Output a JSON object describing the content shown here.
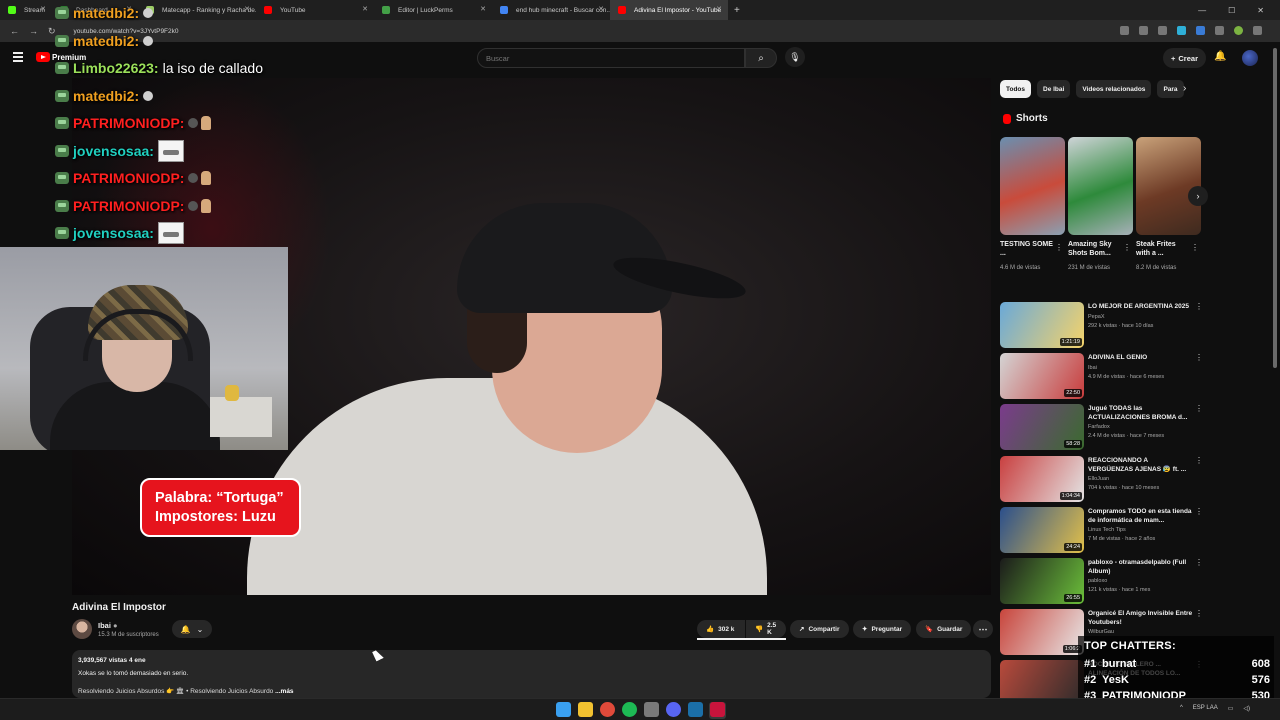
{
  "browser": {
    "tabs": [
      {
        "label": "Stream",
        "color": "#53fc18",
        "active": false,
        "width": 52
      },
      {
        "label": "Dashboard",
        "color": "#2f7d32",
        "active": false,
        "width": 86
      },
      {
        "label": "Matecapp - Ranking y Racha de...",
        "color": "#9ccc65",
        "active": false,
        "width": 118
      },
      {
        "label": "YouTube",
        "color": "#ff0000",
        "active": false,
        "width": 118
      },
      {
        "label": "Editor | LuckPerms",
        "color": "#43a047",
        "active": false,
        "width": 118
      },
      {
        "label": "end hub minecraft - Buscar con...",
        "color": "#4285f4",
        "active": false,
        "width": 118
      },
      {
        "label": "Adivina El Impostor - YouTube",
        "color": "#ff0000",
        "active": true,
        "width": 118
      }
    ],
    "url": "youtube.com/watch?v=3JYvtP9F2k0"
  },
  "header": {
    "brand": "Premium",
    "search_placeholder": "Buscar",
    "create_label": "Crear"
  },
  "chat": [
    {
      "user": "matedbi2:",
      "color": "#f0a020",
      "msg": "",
      "emote": "blur"
    },
    {
      "user": "matedbi2:",
      "color": "#f0a020",
      "msg": "",
      "emote": "blur"
    },
    {
      "user": "Limbo22623:",
      "color": "#9be05a",
      "msg": "la iso de callado",
      "emote": ""
    },
    {
      "user": "matedbi2:",
      "color": "#f0a020",
      "msg": "",
      "emote": "blur"
    },
    {
      "user": "PATRIMONIODP:",
      "color": "#ff2020",
      "msg": "",
      "emote": "hand"
    },
    {
      "user": "jovensosaa:",
      "color": "#20d0c0",
      "msg": "",
      "emote": "img"
    },
    {
      "user": "PATRIMONIODP:",
      "color": "#ff2020",
      "msg": "",
      "emote": "hand"
    },
    {
      "user": "PATRIMONIODP:",
      "color": "#ff2020",
      "msg": "",
      "emote": "hand"
    },
    {
      "user": "jovensosaa:",
      "color": "#20d0c0",
      "msg": "",
      "emote": "img"
    }
  ],
  "video": {
    "caption_line1": "Palabra: “Tortuga”",
    "caption_line2": "Impostores: Luzu",
    "title": "Adivina El Impostor",
    "channel": "Ibai",
    "subscribers": "15.3 M de suscriptores",
    "likes": "302 k",
    "dislikes": "2.5 K",
    "share_label": "Compartir",
    "ask_label": "Preguntar",
    "save_label": "Guardar"
  },
  "description": {
    "stats": "3,939,567 vistas  4 ene",
    "line1": "Xokas se lo tomó demasiado en serio.",
    "line2": "Resolviendo Juicios Absurdos 👉 🏛 • Resolviendo Juicios Absurdo",
    "more": "...más"
  },
  "sidebar": {
    "chips": [
      "Todos",
      "De Ibai",
      "Videos relacionados",
      "Para"
    ],
    "shorts_title": "Shorts",
    "shorts": [
      {
        "title": "TESTING SOME ...",
        "views": "4.6 M de vistas",
        "colors": [
          "#6a8fb0",
          "#c94b3b",
          "#8aa0b2"
        ]
      },
      {
        "title": "Amazing Sky Shots Bom...",
        "views": "231 M de vistas",
        "colors": [
          "#cfd4d8",
          "#2e8a3b",
          "#a7b0b8"
        ]
      },
      {
        "title": "Steak Frites with a ...",
        "views": "8.2 M de vistas",
        "colors": [
          "#c9a27a",
          "#6d3a25",
          "#3e2a1f"
        ]
      }
    ],
    "recs": [
      {
        "title": "LO MEJOR DE ARGENTINA 2025",
        "channel": "PepaX",
        "meta": "292 k vistas · hace 10 días",
        "duration": "1:21:19",
        "colors": [
          "#6aa9d8",
          "#f5d36a"
        ]
      },
      {
        "title": "ADIVINA EL GENIO",
        "channel": "Ibai",
        "meta": "4.9 M de vistas · hace 6 meses",
        "duration": "22:50",
        "colors": [
          "#d4d4d4",
          "#c83c3c"
        ]
      },
      {
        "title": "Jugué TODAS las ACTUALIZACIONES BROMA d...",
        "channel": "Farfadox",
        "meta": "2.4 M de vistas · hace 7 meses",
        "duration": "58:28",
        "colors": [
          "#7b3b8c",
          "#3a6b2e"
        ]
      },
      {
        "title": "REACCIONANDO A VERGÜENZAS AJENAS 😰 ft. ...",
        "channel": "ElloJuan",
        "meta": "704 k vistas · hace 10 meses",
        "duration": "1:04:34",
        "colors": [
          "#c94040",
          "#e4e4e4"
        ]
      },
      {
        "title": "Compramos TODO en esta tienda de informática de mam...",
        "channel": "Linus Tech Tips",
        "meta": "7 M de vistas · hace 2 años",
        "duration": "24:24",
        "colors": [
          "#2b4f8c",
          "#e2c04a"
        ]
      },
      {
        "title": "pabloxo - otramasdelpablo (Full Album)",
        "channel": "pabloxo",
        "meta": "121 k vistas · hace 1 mes",
        "duration": "26:55",
        "colors": [
          "#1b1b1b",
          "#6bbf3a"
        ]
      },
      {
        "title": "Organicé El Amigo Invisible Entre Youtubers!",
        "channel": "WilburGau",
        "meta": "",
        "duration": "1:06:2",
        "colors": [
          "#c8453c",
          "#e8e8e8"
        ]
      },
      {
        "title": "NOCHE FUTBOLERO ... ALINEACIÓN DE TODOS LO...",
        "channel": "",
        "meta": "",
        "duration": "",
        "colors": [
          "#b84a3c",
          "#2a2a2a"
        ]
      }
    ]
  },
  "top_chatters": {
    "title": "TOP CHATTERS:",
    "rows": [
      {
        "rank": "#1",
        "name": "burnat",
        "count": "608"
      },
      {
        "rank": "#2",
        "name": "YesK",
        "count": "576"
      },
      {
        "rank": "#3",
        "name": "PATRIMONIODP",
        "count": "530"
      }
    ]
  },
  "taskbar": {
    "icons": [
      {
        "name": "windows-start-icon",
        "color": "#3aa0f0"
      },
      {
        "name": "file-explorer-icon",
        "color": "#f2c230"
      },
      {
        "name": "chrome-icon",
        "color": "#e04a3a"
      },
      {
        "name": "spotify-icon",
        "color": "#1db954"
      },
      {
        "name": "obs-icon",
        "color": "#7a7a7a"
      },
      {
        "name": "discord-icon",
        "color": "#5865f2"
      },
      {
        "name": "steam-icon",
        "color": "#1b6fa8"
      },
      {
        "name": "streaming-app-icon",
        "color": "#c8143c"
      }
    ],
    "tray_lang": "ESP LAA"
  }
}
